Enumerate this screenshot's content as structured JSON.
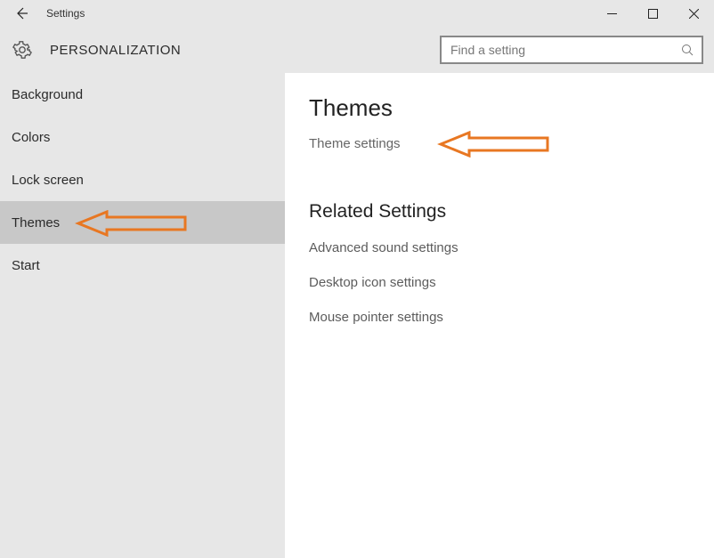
{
  "window": {
    "title": "Settings"
  },
  "header": {
    "category": "PERSONALIZATION",
    "search_placeholder": "Find a setting"
  },
  "sidebar": {
    "items": [
      {
        "label": "Background",
        "selected": false
      },
      {
        "label": "Colors",
        "selected": false
      },
      {
        "label": "Lock screen",
        "selected": false
      },
      {
        "label": "Themes",
        "selected": true
      },
      {
        "label": "Start",
        "selected": false
      }
    ]
  },
  "content": {
    "heading": "Themes",
    "link": "Theme settings",
    "related_heading": "Related Settings",
    "related": [
      "Advanced sound settings",
      "Desktop icon settings",
      "Mouse pointer settings"
    ]
  },
  "annotations": {
    "arrow_color": "#e87722"
  }
}
